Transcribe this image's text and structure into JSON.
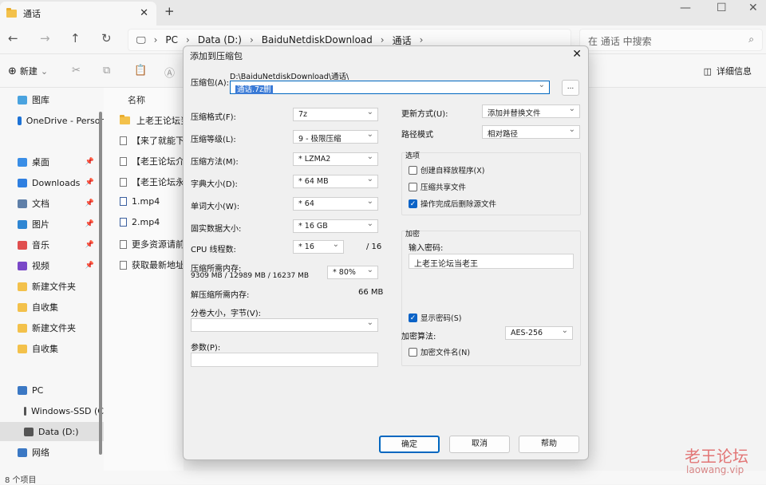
{
  "explorer": {
    "tab_title": "通话",
    "breadcrumb": [
      "PC",
      "Data (D:)",
      "BaiduNetdiskDownload",
      "通话"
    ],
    "search_placeholder": "在 通话 中搜索",
    "toolbar": {
      "new_label": "新建",
      "details_label": "详细信息"
    },
    "sidebar": [
      {
        "label": "图库",
        "icon": "gallery-icon",
        "color": "#4aa3df"
      },
      {
        "label": "OneDrive - Persor",
        "icon": "cloud-icon",
        "color": "#1e73d6"
      },
      {
        "label": "桌面",
        "icon": "desktop-icon",
        "color": "#3a8ee6"
      },
      {
        "label": "Downloads",
        "icon": "download-icon",
        "color": "#2f7fe0"
      },
      {
        "label": "文档",
        "icon": "document-icon",
        "color": "#5f7fa8"
      },
      {
        "label": "图片",
        "icon": "picture-icon",
        "color": "#2f86d3"
      },
      {
        "label": "音乐",
        "icon": "music-icon",
        "color": "#e04f4f"
      },
      {
        "label": "视频",
        "icon": "video-icon",
        "color": "#7a48c8"
      },
      {
        "label": "新建文件夹",
        "icon": "folder-icon",
        "color": "#f3c14b"
      },
      {
        "label": "自收集",
        "icon": "folder-icon",
        "color": "#f3c14b"
      },
      {
        "label": "新建文件夹",
        "icon": "folder-icon",
        "color": "#f3c14b"
      },
      {
        "label": "自收集",
        "icon": "folder-icon",
        "color": "#f3c14b"
      },
      {
        "label": "PC",
        "icon": "pc-icon",
        "color": "#3b78c4"
      },
      {
        "label": "Windows-SSD (C",
        "icon": "drive-icon",
        "color": "#555555"
      },
      {
        "label": "Data (D:)",
        "icon": "drive-icon",
        "color": "#555555"
      },
      {
        "label": "网络",
        "icon": "network-icon",
        "color": "#3b78c4"
      }
    ],
    "column_name": "名称",
    "files": [
      "上老王论坛当老",
      "【来了就能下载",
      "【老王论坛介绍",
      "【老王论坛永久",
      "1.mp4",
      "2.mp4",
      "更多资源请前往",
      "获取最新地址请"
    ],
    "status": "8 个项目",
    "watermark": "老王论坛",
    "watermark_url": "laowang.vip"
  },
  "dialog": {
    "title": "添加到压缩包",
    "archive_label": "压缩包(A):",
    "archive_path": "D:\\BaiduNetdiskDownload\\通话\\",
    "archive_name": "通话.7z删",
    "browse": "...",
    "left": [
      {
        "label": "压缩格式(F):",
        "value": "7z"
      },
      {
        "label": "压缩等级(L):",
        "value": "9 - 极限压缩"
      },
      {
        "label": "压缩方法(M):",
        "value": "* LZMA2"
      },
      {
        "label": "字典大小(D):",
        "value": "* 64 MB"
      },
      {
        "label": "单词大小(W):",
        "value": "* 64"
      },
      {
        "label": "固实数据大小:",
        "value": "* 16 GB"
      }
    ],
    "cpu_label": "CPU 线程数:",
    "cpu_value": "* 16",
    "cpu_total": "/ 16",
    "mem_label": "压缩所需内存:",
    "mem_detail": "9309 MB / 12989 MB / 16237 MB",
    "mem_percent": "* 80%",
    "decomp_label": "解压缩所需内存:",
    "decomp_value": "66 MB",
    "split_label": "分卷大小，字节(V):",
    "params_label": "参数(P):",
    "update_label": "更新方式(U):",
    "update_value": "添加并替换文件",
    "path_label": "路径模式",
    "path_value": "相对路径",
    "options_title": "选项",
    "options": [
      {
        "label": "创建自释放程序(X)",
        "checked": false
      },
      {
        "label": "压缩共享文件",
        "checked": false
      },
      {
        "label": "操作完成后删除源文件",
        "checked": true
      }
    ],
    "enc_title": "加密",
    "pwd_label": "输入密码:",
    "pwd_value": "上老王论坛当老王",
    "show_pwd": "显示密码(S)",
    "enc_method_label": "加密算法:",
    "enc_method": "AES-256",
    "enc_names": "加密文件名(N)",
    "ok": "确定",
    "cancel": "取消",
    "help": "帮助"
  }
}
